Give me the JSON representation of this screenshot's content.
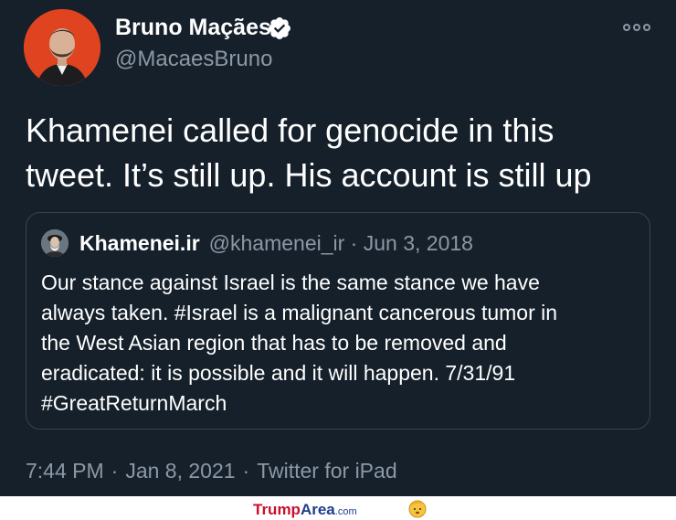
{
  "author": {
    "name": "Bruno Maçães",
    "handle": "@MacaesBruno",
    "verified_icon": "verified-badge-icon",
    "avatar_bg": "#e0431f"
  },
  "menu_icon": "more-options-icon",
  "tweet": {
    "lines": [
      "Khamenei called for genocide in this",
      "tweet. It’s still up. His account is still up"
    ]
  },
  "quoted": {
    "name": "Khamenei.ir",
    "handle_date": "@khamenei_ir · Jun 3, 2018",
    "lines": [
      "Our stance against Israel is the same stance we have",
      "always taken. #Israel is a malignant cancerous tumor in",
      "the West Asian region that has to be removed and",
      "eradicated: it is possible and it will happen. 7/31/91",
      "#GreatReturnMarch"
    ]
  },
  "meta": {
    "time": "7:44 PM",
    "date": "Jan 8, 2021",
    "source": "Twitter for iPad",
    "separator": "·"
  },
  "watermark": {
    "part1": "Trump",
    "part2": "Area",
    "part3": ".com"
  },
  "colors": {
    "background": "#15202b",
    "secondary_text": "#8b98a5",
    "border": "#38444d",
    "verified": "#ffffff"
  }
}
